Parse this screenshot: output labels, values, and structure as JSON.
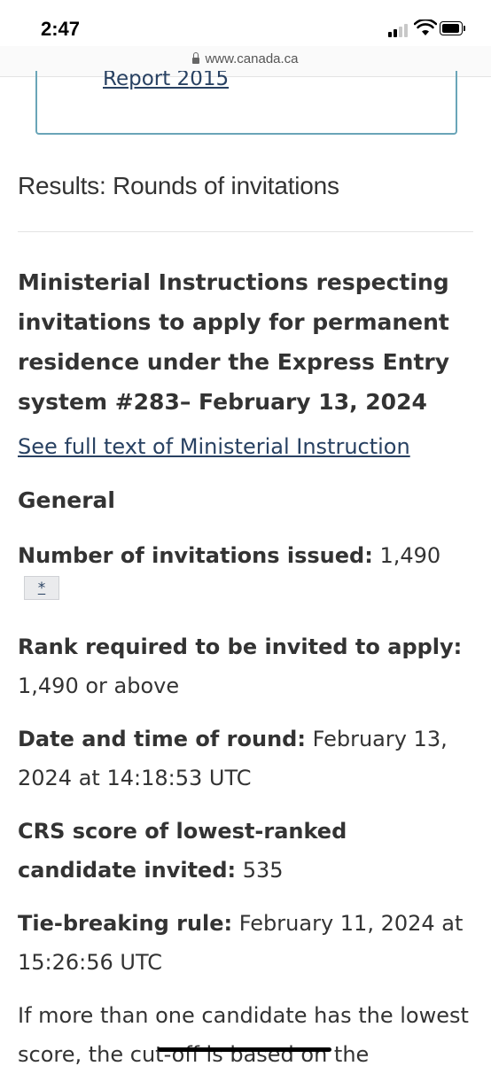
{
  "status_bar": {
    "time": "2:47"
  },
  "browser": {
    "url": "www.canada.ca"
  },
  "report_link": "Report 2015",
  "page_heading": "Results: Rounds of invitations",
  "instruction_title": "Ministerial Instructions respecting invitations to apply for permanent residence under the Express Entry system #283– February 13, 2024",
  "full_text_link": "See full text of Ministerial Instruction",
  "section_label": "General",
  "details": {
    "invitations_label": "Number of invitations issued:",
    "invitations_value": "1,490",
    "footnote": "*",
    "rank_label": "Rank required to be invited to apply:",
    "rank_value": "1,490 or above",
    "date_label": "Date and time of round:",
    "date_value": "February 13, 2024 at 14:18:53 UTC",
    "crs_label": "CRS score of lowest-ranked candidate invited:",
    "crs_value": "535",
    "tie_label": "Tie-breaking rule:",
    "tie_value": "February 11, 2024 at 15:26:56 UTC",
    "tie_note": "If more than one candidate has the lowest score, the cut-off is based on the"
  }
}
